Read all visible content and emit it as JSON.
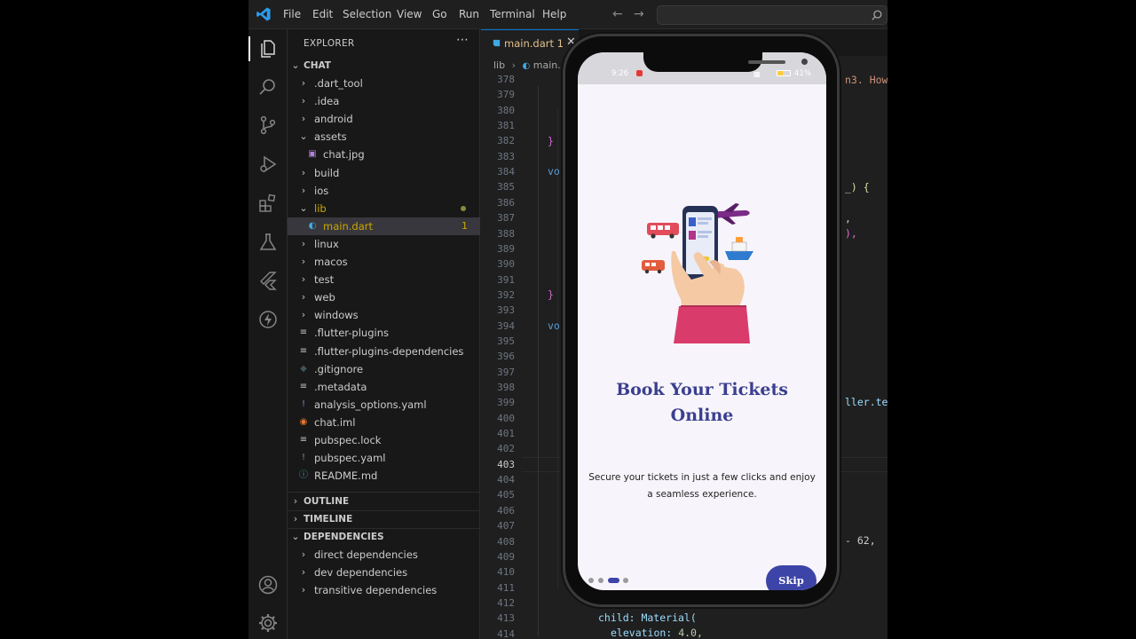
{
  "menu": [
    "File",
    "Edit",
    "Selection",
    "View",
    "Go",
    "Run",
    "Terminal",
    "Help"
  ],
  "explorer": {
    "header": "EXPLORER",
    "project": "CHAT",
    "items": [
      {
        "label": ".dart_tool",
        "kind": "folder",
        "open": false
      },
      {
        "label": ".idea",
        "kind": "folder",
        "open": false
      },
      {
        "label": "android",
        "kind": "folder",
        "open": false
      },
      {
        "label": "assets",
        "kind": "folder",
        "open": true
      },
      {
        "label": "chat.jpg",
        "kind": "image",
        "nested": true
      },
      {
        "label": "build",
        "kind": "folder",
        "open": false
      },
      {
        "label": "ios",
        "kind": "folder",
        "open": false
      },
      {
        "label": "lib",
        "kind": "folder",
        "open": true
      },
      {
        "label": "main.dart",
        "kind": "dart",
        "nested": true
      },
      {
        "label": "linux",
        "kind": "folder",
        "open": false
      },
      {
        "label": "macos",
        "kind": "folder",
        "open": false
      },
      {
        "label": "test",
        "kind": "folder",
        "open": false
      },
      {
        "label": "web",
        "kind": "folder",
        "open": false
      },
      {
        "label": "windows",
        "kind": "folder",
        "open": false
      },
      {
        "label": ".flutter-plugins",
        "kind": "lines"
      },
      {
        "label": ".flutter-plugins-dependencies",
        "kind": "lines"
      },
      {
        "label": ".gitignore",
        "kind": "git"
      },
      {
        "label": ".metadata",
        "kind": "lines"
      },
      {
        "label": "analysis_options.yaml",
        "kind": "yaml"
      },
      {
        "label": "chat.iml",
        "kind": "rss"
      },
      {
        "label": "pubspec.lock",
        "kind": "lines"
      },
      {
        "label": "pubspec.yaml",
        "kind": "yaml"
      },
      {
        "label": "README.md",
        "kind": "info"
      }
    ],
    "main_count": "1",
    "sections": [
      "OUTLINE",
      "TIMELINE",
      "DEPENDENCIES"
    ],
    "dependencies": [
      "direct dependencies",
      "dev dependencies",
      "transitive dependencies"
    ]
  },
  "editor": {
    "tab_label": "main.dart 1",
    "breadcrumb_root": "lib",
    "breadcrumb_file": "main.",
    "line_numbers": [
      "378",
      "379",
      "380",
      "381",
      "382",
      "383",
      "384",
      "385",
      "386",
      "387",
      "388",
      "389",
      "390",
      "391",
      "392",
      "393",
      "394",
      "395",
      "396",
      "397",
      "398",
      "399",
      "400",
      "401",
      "402",
      "403",
      "404",
      "405",
      "406",
      "407",
      "408",
      "409",
      "410",
      "411",
      "412",
      "413",
      "414"
    ],
    "current_line": "403",
    "code_fragments": {
      "r379": "n3. How",
      "r382": "}",
      "r384": "vo",
      "r385": "_) {",
      "r387": ",",
      "r388": "),",
      "r392": "}",
      "r394": "vo",
      "r399": "ller.tex",
      "r408": "- 62,",
      "r412": "child: Material(",
      "r413_key": "elevation:",
      "r413_val": "4.0,"
    }
  },
  "phone": {
    "time": "9:26",
    "battery": "41%",
    "title_line1": "Book Your Tickets",
    "title_line2": "Online",
    "subtitle_line1": "Secure your tickets in just a few clicks and enjoy",
    "subtitle_line2": "a seamless experience.",
    "skip": "Skip",
    "page_count": 4,
    "active_page": 2
  },
  "colors": {
    "accent": "#3d44a8",
    "title": "#3b3f8f",
    "modified": "#cca700"
  }
}
